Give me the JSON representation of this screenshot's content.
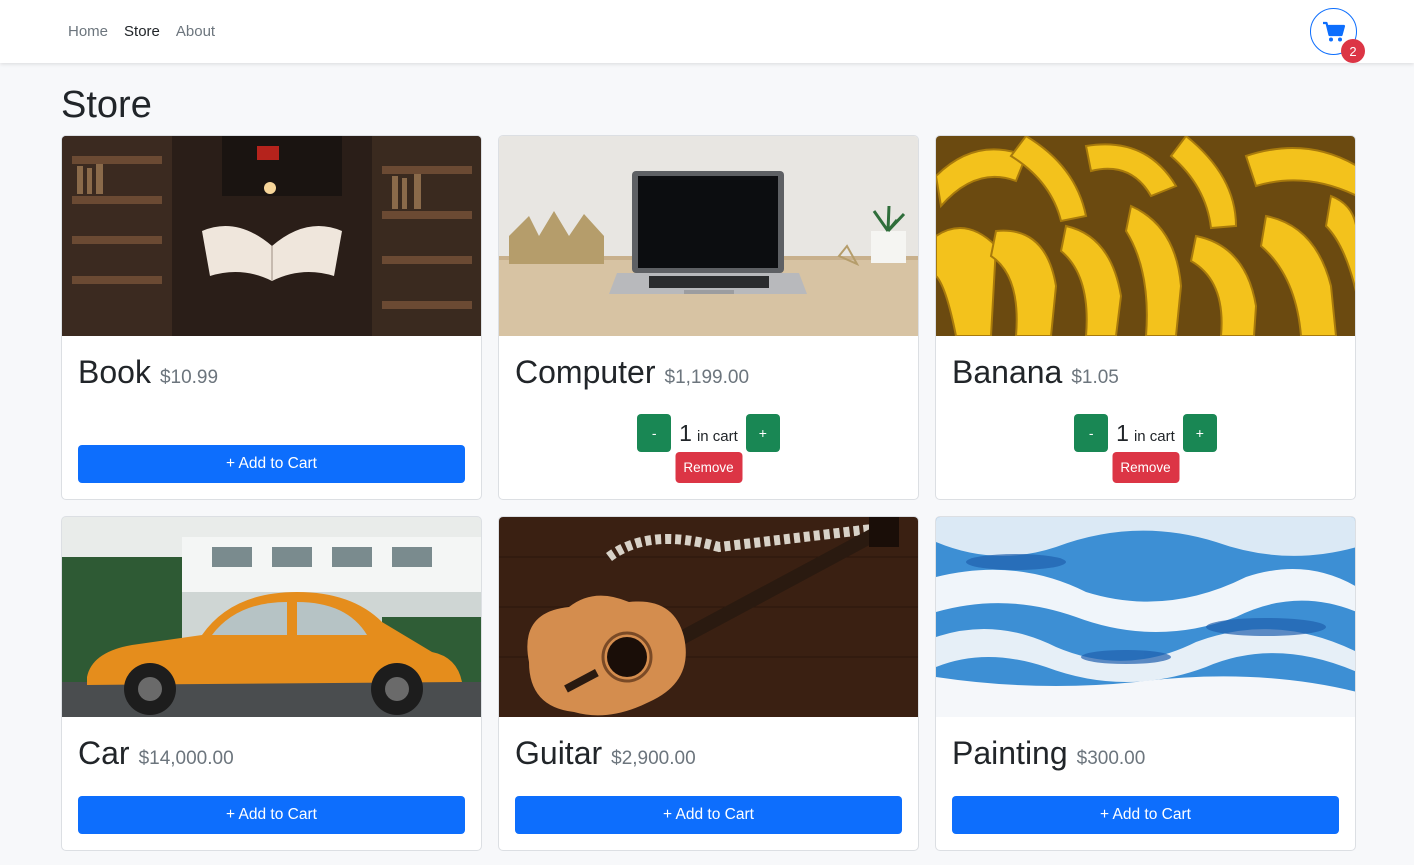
{
  "nav": {
    "links": [
      "Home",
      "Store",
      "About"
    ],
    "cart_count": "2",
    "cart_icon": "shopping-cart-icon"
  },
  "page": {
    "title": "Store"
  },
  "products": [
    {
      "name": "Book",
      "price": "$10.99",
      "add_label": "+ Add to Cart"
    },
    {
      "name": "Computer",
      "price": "$1,199.00",
      "qty": "1",
      "qty_label": "in cart",
      "minus": "-",
      "plus": "+",
      "remove_label": "Remove"
    },
    {
      "name": "Banana",
      "price": "$1.05",
      "qty": "1",
      "qty_label": "in cart",
      "minus": "-",
      "plus": "+",
      "remove_label": "Remove"
    },
    {
      "name": "Car",
      "price": "$14,000.00",
      "add_label": "+ Add to Cart"
    },
    {
      "name": "Guitar",
      "price": "$2,900.00",
      "add_label": "+ Add to Cart"
    },
    {
      "name": "Painting",
      "price": "$300.00",
      "add_label": "+ Add to Cart"
    }
  ],
  "colors": {
    "primary": "#0d6efd",
    "success": "#198754",
    "danger": "#dc3545",
    "muted": "#6c757d"
  }
}
